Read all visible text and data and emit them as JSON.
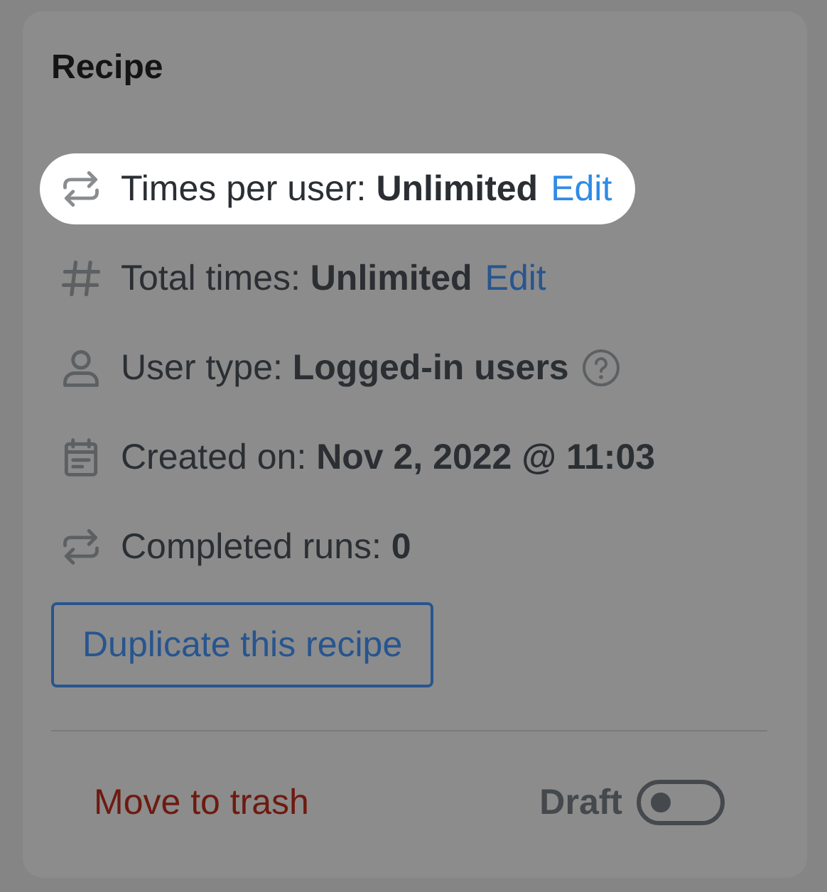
{
  "card": {
    "title": "Recipe"
  },
  "details": [
    {
      "kind": "repeat",
      "label": "Times per user:",
      "value": "Unlimited",
      "link": "Edit",
      "highlighted": true,
      "help": false
    },
    {
      "kind": "hash",
      "label": "Total times:",
      "value": "Unlimited",
      "link": "Edit",
      "highlighted": false,
      "help": false
    },
    {
      "kind": "user",
      "label": "User type:",
      "value": "Logged-in users",
      "highlighted": false,
      "help": true
    },
    {
      "kind": "calendar",
      "label": "Created on:",
      "value": "Nov 2, 2022 @ 11:03",
      "highlighted": false,
      "help": false
    },
    {
      "kind": "repeat",
      "label": "Completed runs:",
      "value": "0",
      "highlighted": false,
      "help": false
    }
  ],
  "duplicate_button": "Duplicate this recipe",
  "trash_link": "Move to trash",
  "status": {
    "label": "Draft",
    "on": false
  }
}
